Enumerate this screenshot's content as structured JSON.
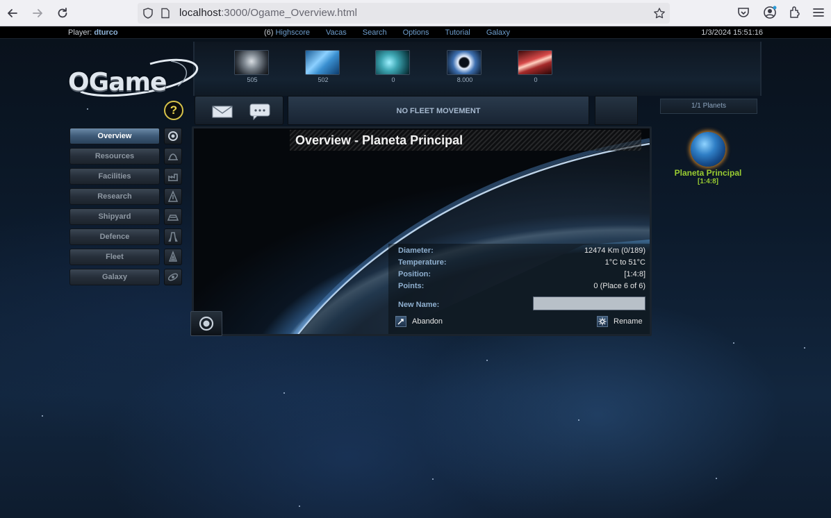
{
  "browser": {
    "url_host": "localhost",
    "url_path": ":3000/Ogame_Overview.html"
  },
  "topbar": {
    "player_label": "Player:",
    "player_name": "dturco",
    "highscore_count": "(6)",
    "menu": [
      "Highscore",
      "Vacas",
      "Search",
      "Options",
      "Tutorial",
      "Galaxy"
    ],
    "clock": "1/3/2024 15:51:16"
  },
  "logo_text": "OGame",
  "help_label": "?",
  "resources": [
    {
      "name": "metal",
      "value": "505",
      "color": "#7a8a9a"
    },
    {
      "name": "crystal",
      "value": "502",
      "color": "#5aa0d8"
    },
    {
      "name": "deuterium",
      "value": "0",
      "color": "#3fa7b4"
    },
    {
      "name": "energy",
      "value": "8.000",
      "color": "#dfe8f5"
    },
    {
      "name": "dark-matter",
      "value": "0",
      "color": "#d84a4a"
    }
  ],
  "left_menu": [
    {
      "label": "Overview",
      "active": true,
      "icon": "planet-icon"
    },
    {
      "label": "Resources",
      "active": false,
      "icon": "mine-icon"
    },
    {
      "label": "Facilities",
      "active": false,
      "icon": "factory-icon"
    },
    {
      "label": "Research",
      "active": false,
      "icon": "flask-icon"
    },
    {
      "label": "Shipyard",
      "active": false,
      "icon": "hangar-icon"
    },
    {
      "label": "Defence",
      "active": false,
      "icon": "turret-icon"
    },
    {
      "label": "Fleet",
      "active": false,
      "icon": "fleet-icon"
    },
    {
      "label": "Galaxy",
      "active": false,
      "icon": "galaxy-icon"
    }
  ],
  "fleet_status": "NO FLEET MOVEMENT",
  "planet_count": "1/1 Planets",
  "overview": {
    "title": "Overview - Planeta Principal",
    "stats": [
      {
        "label": "Diameter:",
        "value": "12474 Km (0/189)"
      },
      {
        "label": "Temperature:",
        "value": "1°C to 51°C"
      },
      {
        "label": "Position:",
        "value": "[1:4:8]"
      },
      {
        "label": "Points:",
        "value": "0 (Place 6 of 6)"
      }
    ],
    "new_name_label": "New Name:",
    "new_name_value": "",
    "abandon_label": "Abandon",
    "rename_label": "Rename"
  },
  "planet": {
    "name": "Planeta Principal",
    "coords": "[1:4:8]"
  }
}
